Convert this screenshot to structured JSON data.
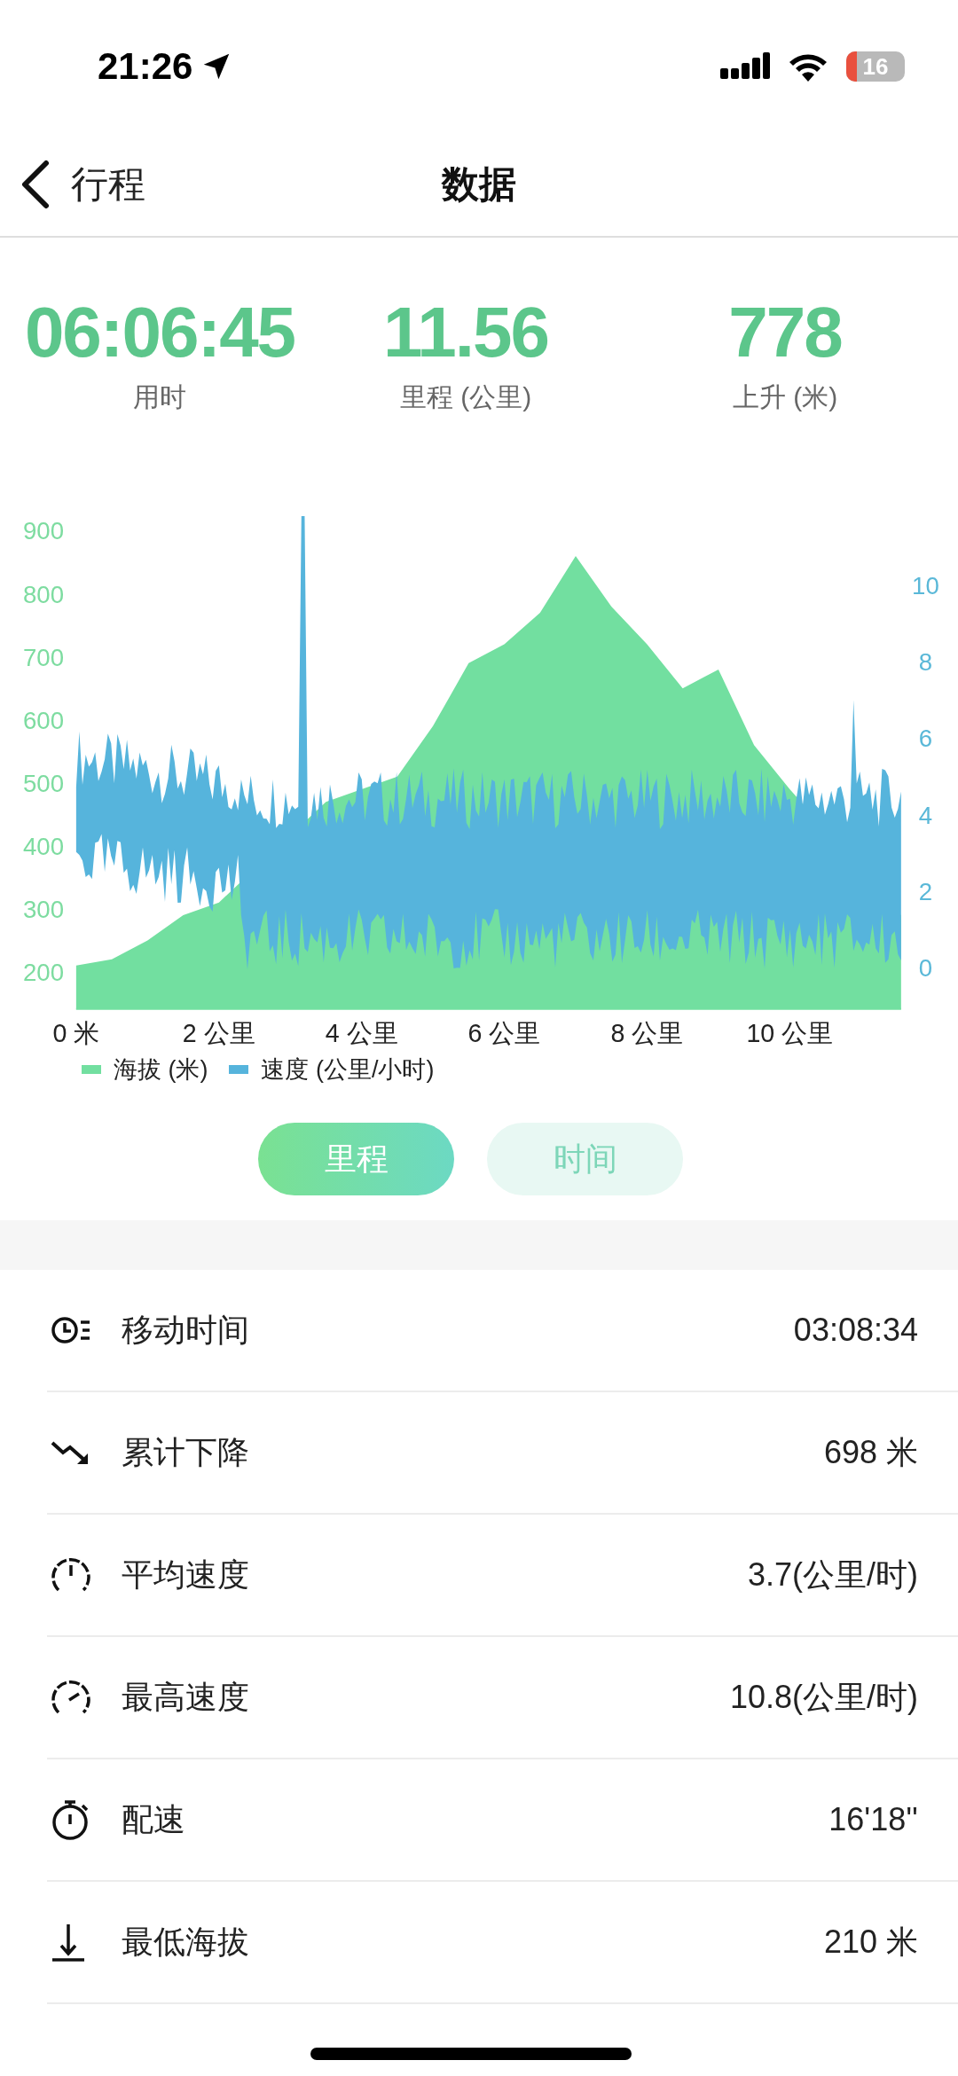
{
  "status_bar": {
    "time": "21:26",
    "battery": "16"
  },
  "nav": {
    "back_label": "行程",
    "title": "数据"
  },
  "stats": [
    {
      "value": "06:06:45",
      "label": "用时"
    },
    {
      "value": "11.56",
      "label": "里程 (公里)"
    },
    {
      "value": "778",
      "label": "上升 (米)"
    }
  ],
  "chart": {
    "chart_data": {
      "type": "area",
      "x": [
        0,
        0.5,
        1,
        1.5,
        2,
        2.5,
        3,
        3.5,
        4,
        4.5,
        5,
        5.5,
        6,
        6.5,
        7,
        7.5,
        8,
        8.5,
        9,
        9.5,
        10,
        10.5,
        11,
        11.56
      ],
      "series": [
        {
          "name": "海拔 (米)",
          "color": "#72dfa0",
          "values": [
            210,
            220,
            250,
            290,
            310,
            null,
            null,
            470,
            null,
            510,
            590,
            690,
            720,
            770,
            860,
            780,
            720,
            650,
            680,
            560,
            490,
            null,
            null,
            290
          ]
        }
      ],
      "xlim": [
        0,
        11.56
      ],
      "ylim": [
        140,
        900
      ],
      "xticks": [
        {
          "value": 0,
          "label": "0 米"
        },
        {
          "value": 2,
          "label": "2 公里"
        },
        {
          "value": 4,
          "label": "4 公里"
        },
        {
          "value": 6,
          "label": "6 公里"
        },
        {
          "value": 8,
          "label": "8 公里"
        },
        {
          "value": 10,
          "label": "10 公里"
        }
      ],
      "yticks": [
        200,
        300,
        400,
        500,
        600,
        700,
        800,
        900
      ]
    },
    "speed_series": {
      "name": "速度 (公里/小时)",
      "color": "#56b4dc"
    },
    "speed_ticks": [
      "10",
      "8",
      "6",
      "4",
      "2",
      "0"
    ]
  },
  "tabs": [
    {
      "label": "里程",
      "selected": true
    },
    {
      "label": "时间",
      "selected": false
    }
  ],
  "metrics": [
    {
      "kind": "clock",
      "label": "移动时间",
      "value": "03:08:34"
    },
    {
      "kind": "descent",
      "label": "累计下降",
      "value": "698 米"
    },
    {
      "kind": "speedometer",
      "label": "平均速度",
      "value": "3.7(公里/时)"
    },
    {
      "kind": "maxspeed",
      "label": "最高速度",
      "value": "10.8(公里/时)"
    },
    {
      "kind": "stopwatch",
      "label": "配速",
      "value": "16'18''"
    },
    {
      "kind": "lowest",
      "label": "最低海拔",
      "value": "210 米"
    }
  ]
}
